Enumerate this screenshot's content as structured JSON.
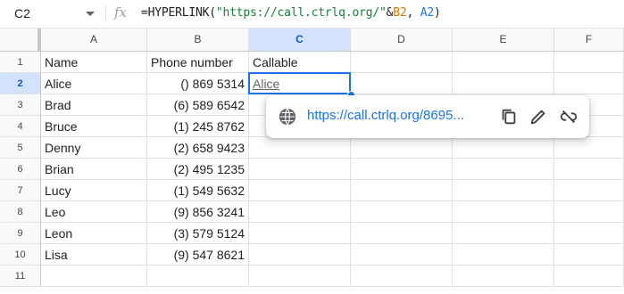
{
  "formula_bar": {
    "cell_ref": "C2",
    "fx_label": "fx",
    "formula_prefix": "=HYPERLINK(",
    "formula_string": "\"https://call.ctrlq.org/\"",
    "formula_amp": "&",
    "formula_arg1": "B2",
    "formula_sep": ", ",
    "formula_arg2": "A2",
    "formula_suffix": ")"
  },
  "columns": [
    "A",
    "B",
    "C",
    "D",
    "E",
    "F"
  ],
  "selected_column": "C",
  "rows": [
    {
      "num": "1",
      "a": "Name",
      "b": "Phone number",
      "c": "Callable"
    },
    {
      "num": "2",
      "a": "Alice",
      "b": "() 869 5314",
      "c": "Alice"
    },
    {
      "num": "3",
      "a": "Brad",
      "b": "(6) 589 6542",
      "c": ""
    },
    {
      "num": "4",
      "a": "Bruce",
      "b": "(1) 245 8762",
      "c": ""
    },
    {
      "num": "5",
      "a": "Denny",
      "b": "(2) 658 9423",
      "c": ""
    },
    {
      "num": "6",
      "a": "Brian",
      "b": "(2) 495 1235",
      "c": ""
    },
    {
      "num": "7",
      "a": "Lucy",
      "b": "(1) 549 5632",
      "c": ""
    },
    {
      "num": "8",
      "a": "Leo",
      "b": "(9) 856 3241",
      "c": ""
    },
    {
      "num": "9",
      "a": "Leon",
      "b": "(3) 579 5124",
      "c": ""
    },
    {
      "num": "10",
      "a": "Lisa",
      "b": "(9) 547 8621",
      "c": ""
    },
    {
      "num": "11",
      "a": "",
      "b": "",
      "c": ""
    }
  ],
  "selected_row": "2",
  "link_popup": {
    "url": "https://call.ctrlq.org/8695...",
    "icons": [
      "globe-icon",
      "copy-icon",
      "edit-icon",
      "unlink-icon"
    ]
  },
  "colors": {
    "selection": "#1a73e8",
    "selected_header_bg": "#d3e3fd",
    "link_text": "#1a73e8",
    "formula_string": "#188038",
    "formula_ref_b2": "#e37400",
    "formula_ref_a2": "#1a73e8"
  }
}
